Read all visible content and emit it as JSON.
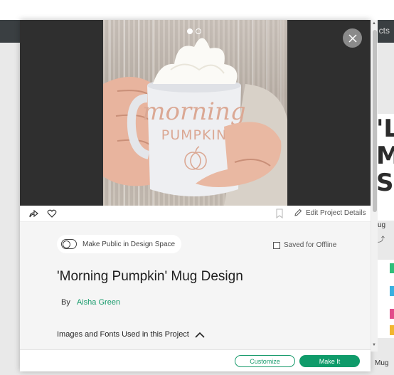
{
  "background": {
    "nav_partial_text": "cts",
    "card_letters": [
      "'L",
      "M",
      "S"
    ],
    "card_label": "ug",
    "card2_label": "Mug",
    "stripe_colors": [
      "#2fbf7a",
      "#3ab0e0",
      "#e24b8a",
      "#f2b630",
      "#2fbf7a"
    ]
  },
  "modal": {
    "carousel": {
      "image": {
        "mug_text_line1": "morning",
        "mug_text_line2": "PUMPKIN"
      },
      "dots": [
        {
          "active": true
        },
        {
          "active": false
        }
      ],
      "close_icon": "close-icon"
    },
    "actions": {
      "share_icon": "share-icon",
      "favorite_icon": "heart-icon",
      "bookmark_icon": "bookmark-icon",
      "edit_label": "Edit Project Details"
    },
    "details": {
      "public_toggle_label": "Make Public in Design Space",
      "offline_label": "Saved for Offline",
      "title": "'Morning Pumpkin' Mug Design",
      "by_label": "By",
      "author": "Aisha Green",
      "images_fonts_label": "Images and Fonts Used in this Project"
    },
    "footer": {
      "customize_label": "Customize",
      "make_it_label": "Make It"
    }
  },
  "colors": {
    "accent": "#189b6c",
    "primary_button": "#0f9b6a",
    "navbar": "#3a3f42",
    "carousel_bg": "#2f2f2f"
  }
}
